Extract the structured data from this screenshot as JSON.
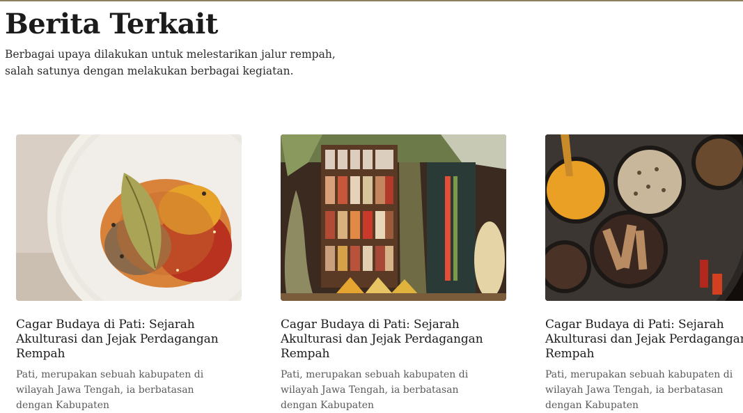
{
  "section": {
    "title": "Berita Terkait",
    "description": "Berbagai upaya dilakukan untuk melestarikan jalur rempah, salah satunya dengan melakukan berbagai kegiatan."
  },
  "cards": [
    {
      "title": "Cagar Budaya di Pati: Sejarah Akulturasi dan Jejak Perdagangan Rempah",
      "excerpt": "Pati, merupakan sebuah kabupaten di wilayah Jawa Tengah, ia berbatasan dengan Kabupaten",
      "image": "bowl-of-ground-spices-with-bay-leaf"
    },
    {
      "title": "Cagar Budaya di Pati: Sejarah Akulturasi dan Jejak Perdagangan Rempah",
      "excerpt": "Pati, merupakan sebuah kabupaten di wilayah Jawa Tengah, ia berbatasan dengan Kabupaten",
      "image": "spice-market-shelves-with-jars"
    },
    {
      "title": "Cagar Budaya di Pati: Sejarah Akulturasi dan Jejak Perdagangan Rempah",
      "excerpt": "Pati, merupakan sebuah kabupaten di wilayah Jawa Tengah, ia berbatasan dengan Kabupaten",
      "image": "spice-tin-with-turmeric-pepper-cinnamon"
    }
  ]
}
